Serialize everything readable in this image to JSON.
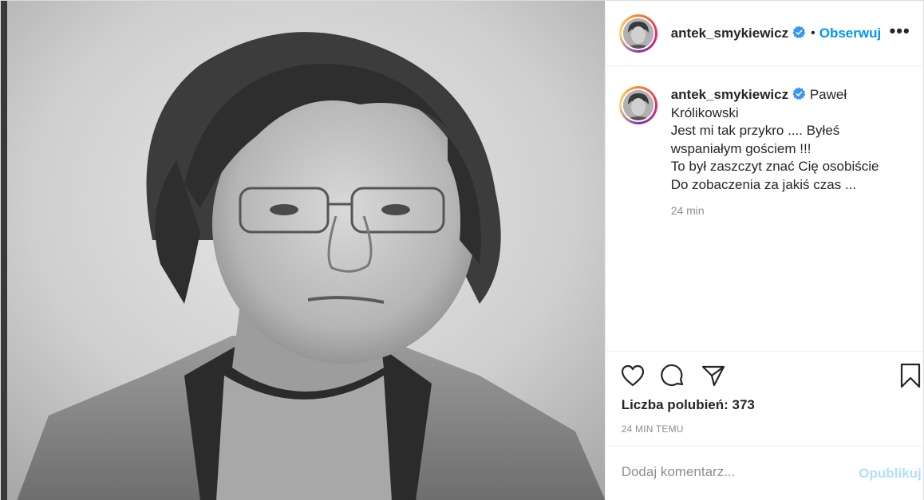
{
  "post": {
    "author": {
      "username": "antek_smykiewicz",
      "verified": true,
      "follow_label": "Obserwuj",
      "separator": "•"
    },
    "more_options_label": "•••",
    "caption": {
      "username": "antek_smykiewicz",
      "text_parts": [
        "Paweł",
        "Królikowski",
        "Jest mi tak przykro .... Byłeś",
        "wspaniałym gościem !!!",
        "To był zaszczyt znać Cię osobiście",
        "Do zobaczenia za jakiś czas ..."
      ],
      "time": "24 min"
    },
    "actions": {
      "icons": [
        "heart-icon",
        "comment-icon",
        "share-icon",
        "bookmark-icon"
      ]
    },
    "likes_text": "Liczba polubień: 373",
    "time_ago": "24 MIN TEMU",
    "comment": {
      "placeholder": "Dodaj komentarz...",
      "publish_label": "Opublikuj"
    },
    "colors": {
      "accent": "#0095f6",
      "publish_disabled": "#b2dffc",
      "muted": "#8e8e8e",
      "text": "#262626",
      "verified": "#3897f0"
    }
  }
}
